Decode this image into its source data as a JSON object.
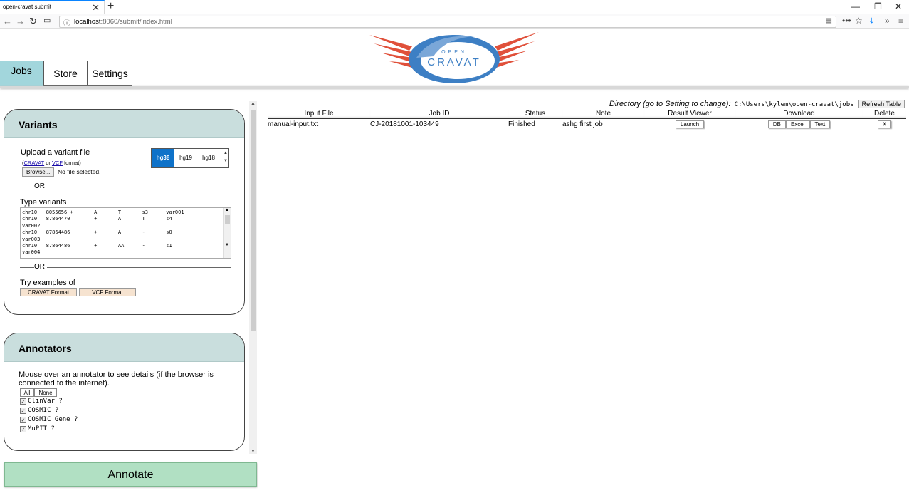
{
  "browser": {
    "tab_title": "open-cravat submit",
    "url_host": "localhost",
    "url_rest": ":8060/submit/index.html"
  },
  "nav": {
    "tabs": [
      {
        "label": "Jobs",
        "active": true
      },
      {
        "label": "Store",
        "active": false
      },
      {
        "label": "Settings",
        "active": false
      }
    ]
  },
  "logo": {
    "small_text": "OPEN",
    "big_text": "CRAVAT"
  },
  "variants": {
    "title": "Variants",
    "upload_label": "Upload a variant file",
    "format_prefix": "(",
    "format_cravat": "CRAVAT",
    "format_or": " or ",
    "format_vcf": "VCF",
    "format_suffix": " format)",
    "browse_label": "Browse...",
    "no_file": "No file selected.",
    "genomes": [
      "hg38",
      "hg19",
      "hg18"
    ],
    "selected_genome": "hg38",
    "or_label": "OR",
    "type_label": "Type variants",
    "textarea_value": "chr10   8055656 +       A       T       s3      var001\nchr10   87864470        +       A       T       s4\nvar002\nchr10   87864486        +       A       -       s0\nvar003\nchr10   87864486        +       AA      -       s1\nvar004",
    "examples_label": "Try examples of",
    "example_cravat": "CRAVAT Format",
    "example_vcf": "VCF Format"
  },
  "annotators": {
    "title": "Annotators",
    "hint": "Mouse over an annotator to see details (if the browser is connected to the internet).",
    "all_label": "All",
    "none_label": "None",
    "items": [
      {
        "name": "ClinVar",
        "checked": true
      },
      {
        "name": "COSMIC",
        "checked": true
      },
      {
        "name": "COSMIC Gene",
        "checked": true
      },
      {
        "name": "MuPIT",
        "checked": true
      }
    ],
    "help_mark": "?"
  },
  "annotate_label": "Annotate",
  "jobs": {
    "dir_label": "Directory (go to Setting to change):",
    "dir_path": "C:\\Users\\kylem\\open-cravat\\jobs",
    "refresh_label": "Refresh Table",
    "columns": [
      "Input File",
      "Job ID",
      "Status",
      "Note",
      "Result Viewer",
      "Download",
      "Delete"
    ],
    "rows": [
      {
        "input_file": "manual-input.txt",
        "job_id": "CJ-20181001-103449",
        "status": "Finished",
        "note": "ashg first job",
        "viewer_label": "Launch",
        "downloads": [
          "DB",
          "Excel",
          "Text"
        ],
        "delete_label": "X"
      }
    ]
  },
  "colors": {
    "nav_active": "#a2d6dc",
    "card_header": "#c9dedd",
    "genome_selected": "#0e72c9",
    "example_button": "#f6e3d0",
    "annotate_button": "#b1e0c3",
    "logo_red": "#e0503a",
    "logo_blue": "#3d7fc4"
  },
  "icons": {
    "back": "arrow-left-icon",
    "forward": "arrow-right-icon",
    "reload": "reload-icon",
    "sidebar": "sidebar-icon",
    "info": "info-icon",
    "reader": "reader-view-icon",
    "more": "more-icon",
    "bookmark": "star-icon",
    "download": "download-icon",
    "overflow": "chevron-right-double-icon",
    "menu": "hamburger-menu-icon"
  }
}
